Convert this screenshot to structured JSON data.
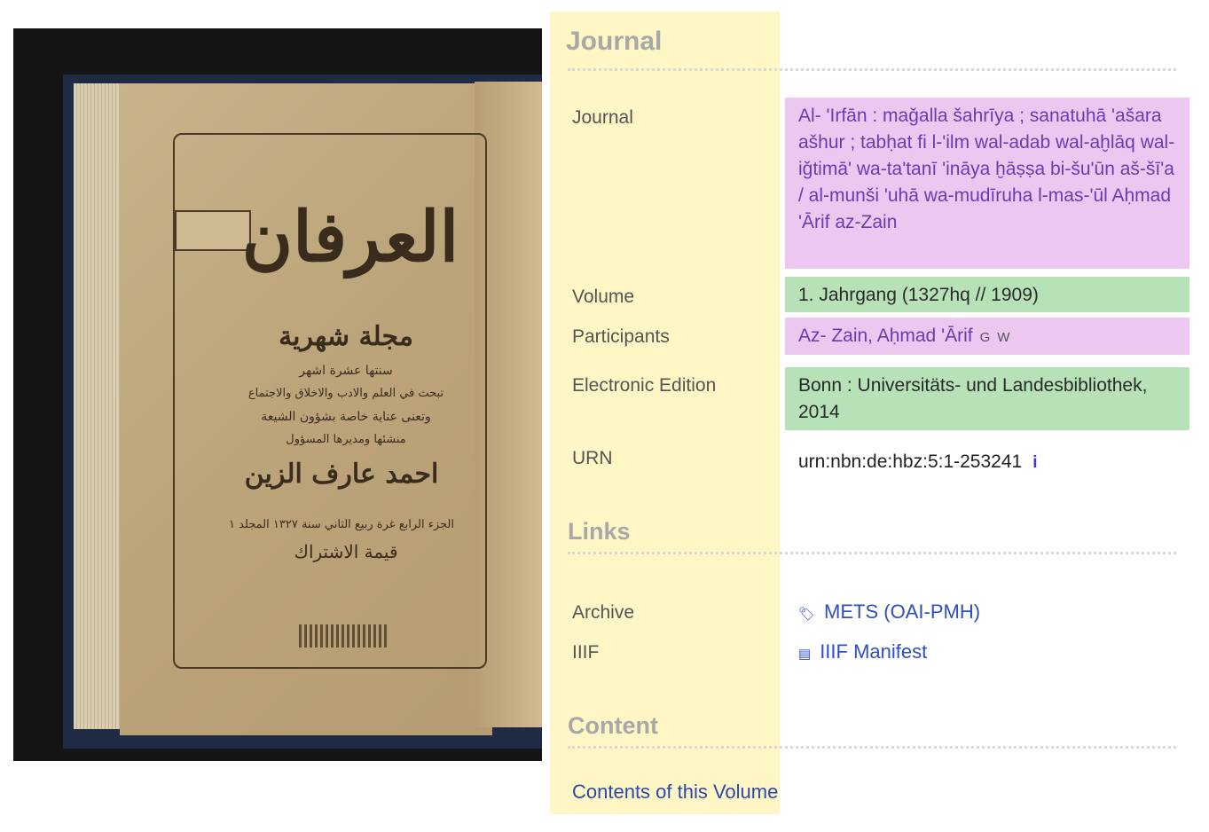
{
  "cover": {
    "title_ar": "العرفان",
    "subtitle_ar": "مجلة شهرية",
    "lines_ar": [
      "سنتها عشرة اشهر",
      "تبحث في العلم والادب والاخلاق والاجتماع",
      "وتعنى عناية خاصة بشؤون الشيعة",
      "منشئها ومديرها المسؤول"
    ],
    "editor_ar": "احمد عارف الزين",
    "issue_ar": "الجزء الرابع   غرة ربيع الثاني سنة ١٣٢٧   المجلد ١",
    "subscription_ar": "قيمة الاشتراك"
  },
  "journal_section": {
    "title": "Journal",
    "journal_label": "Journal",
    "journal_value": "Al- 'Irfān : maǧalla šahrīya ; sanatuhā 'ašara ašhur ; tabḥat fi l-'ilm wal-adab wal-aḫlāq wal-iǧtimā' wa-ta'tanī 'ināya ḫāṣṣa bi-šu'ūn aš-šī'a / al-munši 'uhā wa-mudīruha l-mas-'ūl Aḥmad 'Ārif az-Zain",
    "volume_label": "Volume",
    "volume_value": "1. Jahrgang (1327hq // 1909)",
    "participants_label": "Participants",
    "participants_value": "Az- Zain, Aḥmad 'Ārif",
    "participants_g": "G",
    "participants_w": "W",
    "edition_label": "Electronic Edition",
    "edition_value": "Bonn : Universitäts- und Landesbibliothek, 2014",
    "urn_label": "URN",
    "urn_value": "urn:nbn:de:hbz:5:1-253241",
    "urn_info": "i"
  },
  "links_section": {
    "title": "Links",
    "archive_label": "Archive",
    "archive_link": "METS (OAI-PMH)",
    "iiif_label": "IIIF",
    "iiif_link": "IIIF Manifest"
  },
  "content_section": {
    "title": "Content",
    "contents_link": "Contents of this Volume"
  },
  "colors": {
    "highlight_yellow": "#fff4bc",
    "highlight_pink": "#ecc7ef",
    "highlight_green": "#b7e2b7",
    "link_blue": "#2d4fc0"
  }
}
